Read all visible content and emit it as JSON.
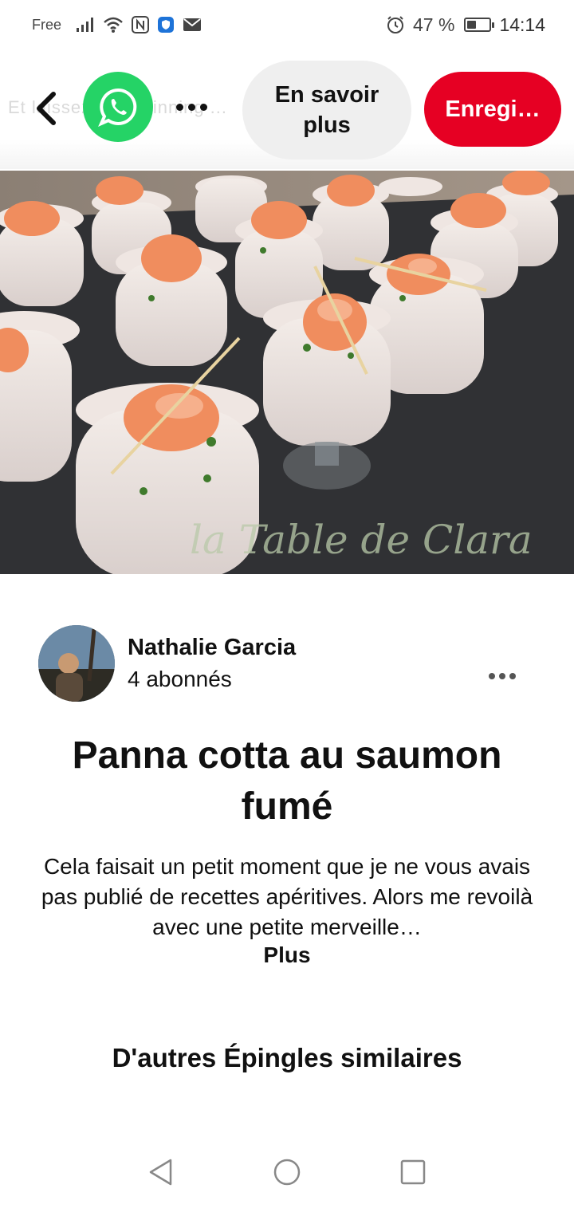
{
  "status_bar": {
    "carrier": "Free",
    "battery_percent": "47 %",
    "battery_level": 0.47,
    "time": "14:14",
    "icons": [
      "signal-icon",
      "wifi-icon",
      "nfc-icon",
      "shield-app-icon",
      "mail-icon",
      "alarm-icon",
      "battery-icon"
    ]
  },
  "top_bar": {
    "ghost_text": "Et laissez faire Pinning  ...",
    "back_icon": "chevron-left-icon",
    "share_icon": "whatsapp-icon",
    "more_icon": "ellipsis-icon",
    "learn_more_label": "En savoir plus",
    "save_label": "Enregi…",
    "save_color": "#e60023",
    "whatsapp_color": "#25d366"
  },
  "hero": {
    "watermark": "la Table de Clara",
    "lens_icon": "visual-search-icon"
  },
  "author": {
    "name": "Nathalie Garcia",
    "followers": "4 abonnés",
    "more_icon": "ellipsis-icon"
  },
  "pin": {
    "title": "Panna cotta au saumon fumé",
    "description": "Cela faisait un petit moment que je ne vous avais pas publié de recettes apéritives. Alors me revoilà avec une petite merveille…",
    "more_label": "Plus"
  },
  "similar": {
    "heading": "D'autres Épingles similaires"
  },
  "nav": {
    "back_icon": "triangle-back-icon",
    "home_icon": "circle-home-icon",
    "recents_icon": "square-recents-icon"
  }
}
